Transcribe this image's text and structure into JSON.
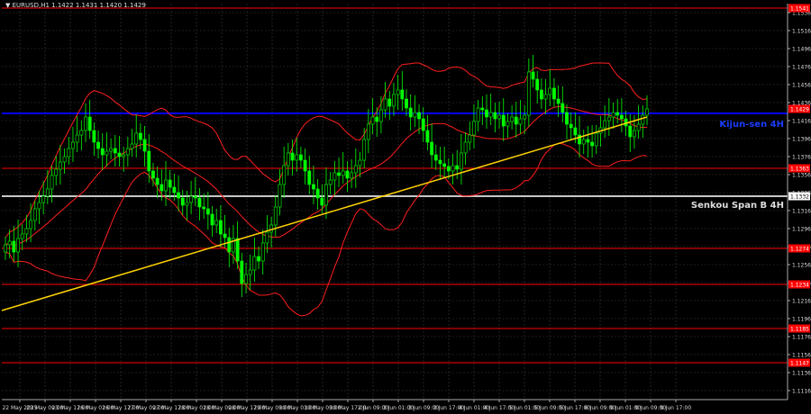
{
  "header": {
    "symbol_label": "EURUSD,H1",
    "quote": "1.1422 1.1431 1.1420 1.1429"
  },
  "colors": {
    "background": "#000000",
    "grid": "#3a3a3a",
    "bull_candle": "#00ff00",
    "bear_candle": "#00ff00",
    "bands": "#ff1e1e",
    "trendline": "#ffd200",
    "kijun": "#0000ff",
    "senkou": "#c8c8c8",
    "level_label_bg": "#ff0000",
    "current_price_bg": "#ff0000"
  },
  "chart_data": {
    "type": "candlestick",
    "ylim": [
      1.1106,
      1.1546
    ],
    "y_ticks": [
      "1.1536",
      "1.1516",
      "1.1496",
      "1.1476",
      "1.1456",
      "1.1436",
      "1.1416",
      "1.1396",
      "1.1376",
      "1.1356",
      "1.1336",
      "1.1316",
      "1.1296",
      "1.1276",
      "1.1256",
      "1.1236",
      "1.1216",
      "1.1196",
      "1.1176",
      "1.1156",
      "1.1136",
      "1.1116"
    ],
    "x_ticks": [
      "22 May 2025",
      "23 May 09:00",
      "23 May 17:00",
      "26 May 01:00",
      "26 May 17:00",
      "27 May 09:00",
      "27 May 17:00",
      "28 May 01:00",
      "28 May 09:00",
      "28 May 17:00",
      "29 May 09:00",
      "30 May 01:00",
      "30 May 09:00",
      "30 May 17:00",
      "2 Jun 09:00",
      "3 Jun 01:00",
      "3 Jun 09:00",
      "3 Jun 17:00",
      "4 Jun 01:00",
      "4 Jun 17:00",
      "5 Jun 01:00",
      "5 Jun 09:00",
      "5 Jun 17:00",
      "6 Jun 09:00",
      "9 Jun 01:00",
      "9 Jun 09:00",
      "9 Jun 17:00"
    ],
    "levels": [
      {
        "price": 1.1541,
        "label": "1.1541",
        "color": "#ff0000"
      },
      {
        "price": 1.1363,
        "label": "1.1363",
        "color": "#ff0000"
      },
      {
        "price": 1.1274,
        "label": "1.1274",
        "color": "#ff0000"
      },
      {
        "price": 1.1234,
        "label": "1.1234",
        "color": "#ff0000"
      },
      {
        "price": 1.1185,
        "label": "1.1185",
        "color": "#ff0000"
      },
      {
        "price": 1.1147,
        "label": "1.1147",
        "color": "#ff0000"
      }
    ],
    "kijun": {
      "price": 1.1424,
      "label": "Kijun-sen 4H"
    },
    "senkou": {
      "price": 1.1332,
      "label": "Senkou Span B 4H",
      "tag": "1.1332"
    },
    "current_price": {
      "price": 1.1429,
      "label": "1.1429"
    },
    "trendline": {
      "start": 1.1205,
      "end": 1.142
    },
    "candles_close": [
      1.1278,
      1.1282,
      1.127,
      1.1285,
      1.129,
      1.1296,
      1.1305,
      1.1318,
      1.1325,
      1.1332,
      1.134,
      1.1355,
      1.1362,
      1.137,
      1.1376,
      1.1385,
      1.1392,
      1.14,
      1.1405,
      1.142,
      1.1405,
      1.1392,
      1.1385,
      1.1378,
      1.1382,
      1.1385,
      1.138,
      1.1376,
      1.1378,
      1.1385,
      1.139,
      1.1402,
      1.1395,
      1.1382,
      1.136,
      1.1352,
      1.1345,
      1.1338,
      1.135,
      1.1342,
      1.1336,
      1.133,
      1.1322,
      1.1325,
      1.1332,
      1.133,
      1.132,
      1.1318,
      1.1312,
      1.13,
      1.1305,
      1.129,
      1.1286,
      1.127,
      1.1285,
      1.126,
      1.1235,
      1.1245,
      1.125,
      1.1265,
      1.126,
      1.128,
      1.1292,
      1.13,
      1.132,
      1.1345,
      1.1366,
      1.138,
      1.1372,
      1.1378,
      1.1372,
      1.136,
      1.1345,
      1.134,
      1.133,
      1.1322,
      1.1345,
      1.135,
      1.1358,
      1.1355,
      1.136,
      1.1352,
      1.1358,
      1.1366,
      1.1372,
      1.1395,
      1.1412,
      1.142,
      1.1415,
      1.1428,
      1.144,
      1.1432,
      1.1445,
      1.145,
      1.144,
      1.143,
      1.142,
      1.1425,
      1.1418,
      1.1405,
      1.1392,
      1.1378,
      1.1372,
      1.1368,
      1.1365,
      1.136,
      1.1366,
      1.1362,
      1.138,
      1.1392,
      1.14,
      1.1415,
      1.143,
      1.1428,
      1.142,
      1.1425,
      1.1418,
      1.1422,
      1.141,
      1.1415,
      1.142,
      1.1412,
      1.1418,
      1.1422,
      1.147,
      1.1462,
      1.145,
      1.144,
      1.1445,
      1.1452,
      1.144,
      1.1435,
      1.1425,
      1.1412,
      1.1408,
      1.14,
      1.139,
      1.1395,
      1.1392,
      1.1388,
      1.1402,
      1.1408,
      1.1416,
      1.142,
      1.1425,
      1.1422,
      1.1418,
      1.141,
      1.1398,
      1.1405,
      1.1412,
      1.1422,
      1.1429
    ]
  }
}
